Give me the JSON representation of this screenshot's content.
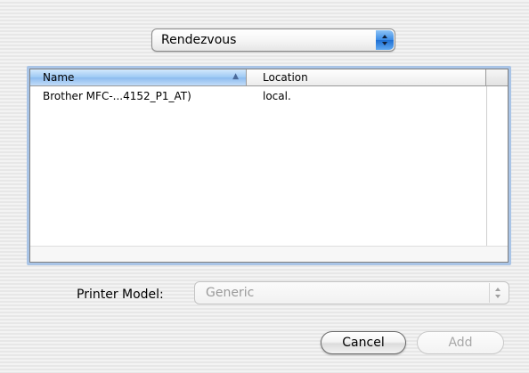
{
  "connection_popup": {
    "selected": "Rendezvous"
  },
  "printer_list": {
    "columns": [
      "Name",
      "Location"
    ],
    "sorted_column": "Name",
    "sort_direction": "ascending",
    "rows": [
      {
        "name": "Brother MFC-...4152_P1_AT)",
        "location": "local."
      }
    ]
  },
  "printer_model": {
    "label": "Printer Model:",
    "selected": "Generic",
    "enabled": false
  },
  "buttons": {
    "cancel": "Cancel",
    "add": "Add"
  },
  "colors": {
    "accent": "#3a8be6",
    "focus_ring": "#a9c4e6",
    "disabled_text": "#9a9a9a"
  }
}
